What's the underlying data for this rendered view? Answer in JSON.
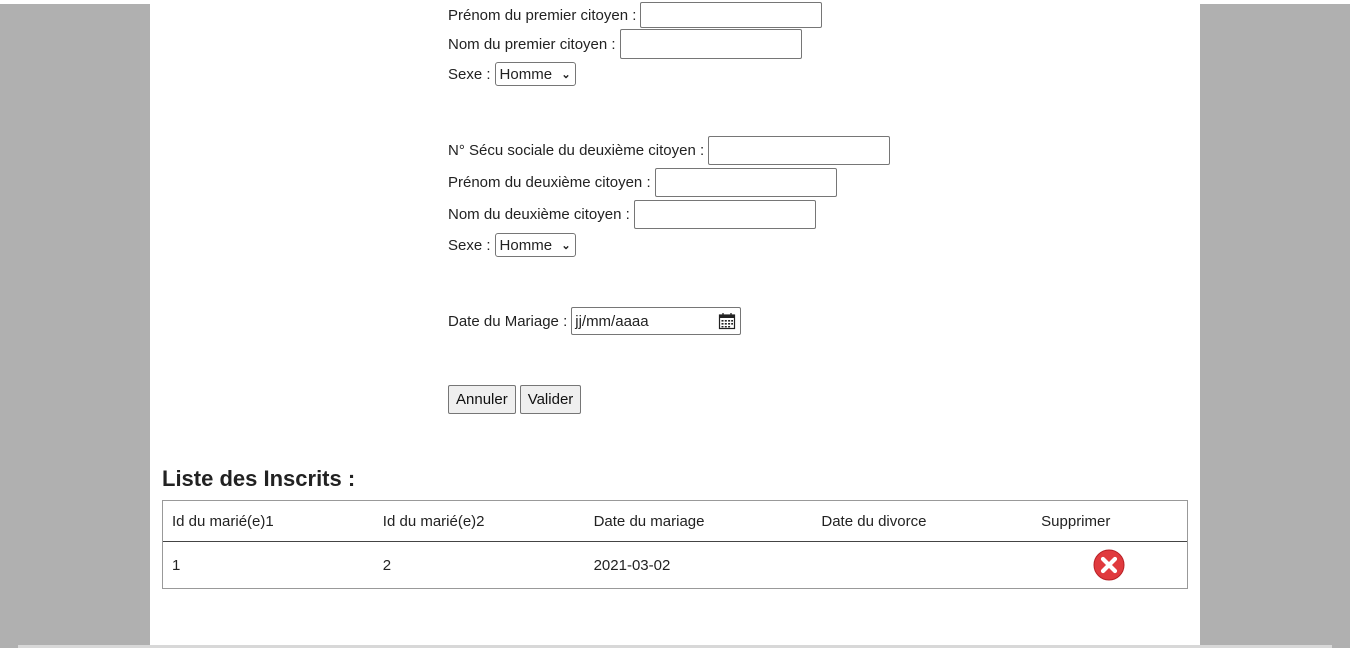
{
  "form": {
    "first_citizen": {
      "firstname_label": "Prénom du premier citoyen :",
      "lastname_label": "Nom du premier citoyen :",
      "sex_label": "Sexe :",
      "sex_value": "Homme"
    },
    "second_citizen": {
      "ssn_label": "N° Sécu sociale du deuxième citoyen :",
      "firstname_label": "Prénom du deuxième citoyen :",
      "lastname_label": "Nom du deuxième citoyen :",
      "sex_label": "Sexe :",
      "sex_value": "Homme"
    },
    "marriage_date_label": "Date du Mariage :",
    "marriage_date_placeholder": "jj/mm/aaaa",
    "cancel_label": "Annuler",
    "submit_label": "Valider"
  },
  "list": {
    "title": "Liste des Inscrits :",
    "columns": [
      "Id du marié(e)1",
      "Id du marié(e)2",
      "Date du mariage",
      "Date du divorce",
      "Supprimer"
    ],
    "rows": [
      {
        "id1": "1",
        "id2": "2",
        "marriage_date": "2021-03-02",
        "divorce_date": "",
        "delete_icon": "delete-x-icon"
      }
    ]
  },
  "colors": {
    "delete_red": "#e03a3e",
    "page_bg": "#b0b0b0"
  }
}
